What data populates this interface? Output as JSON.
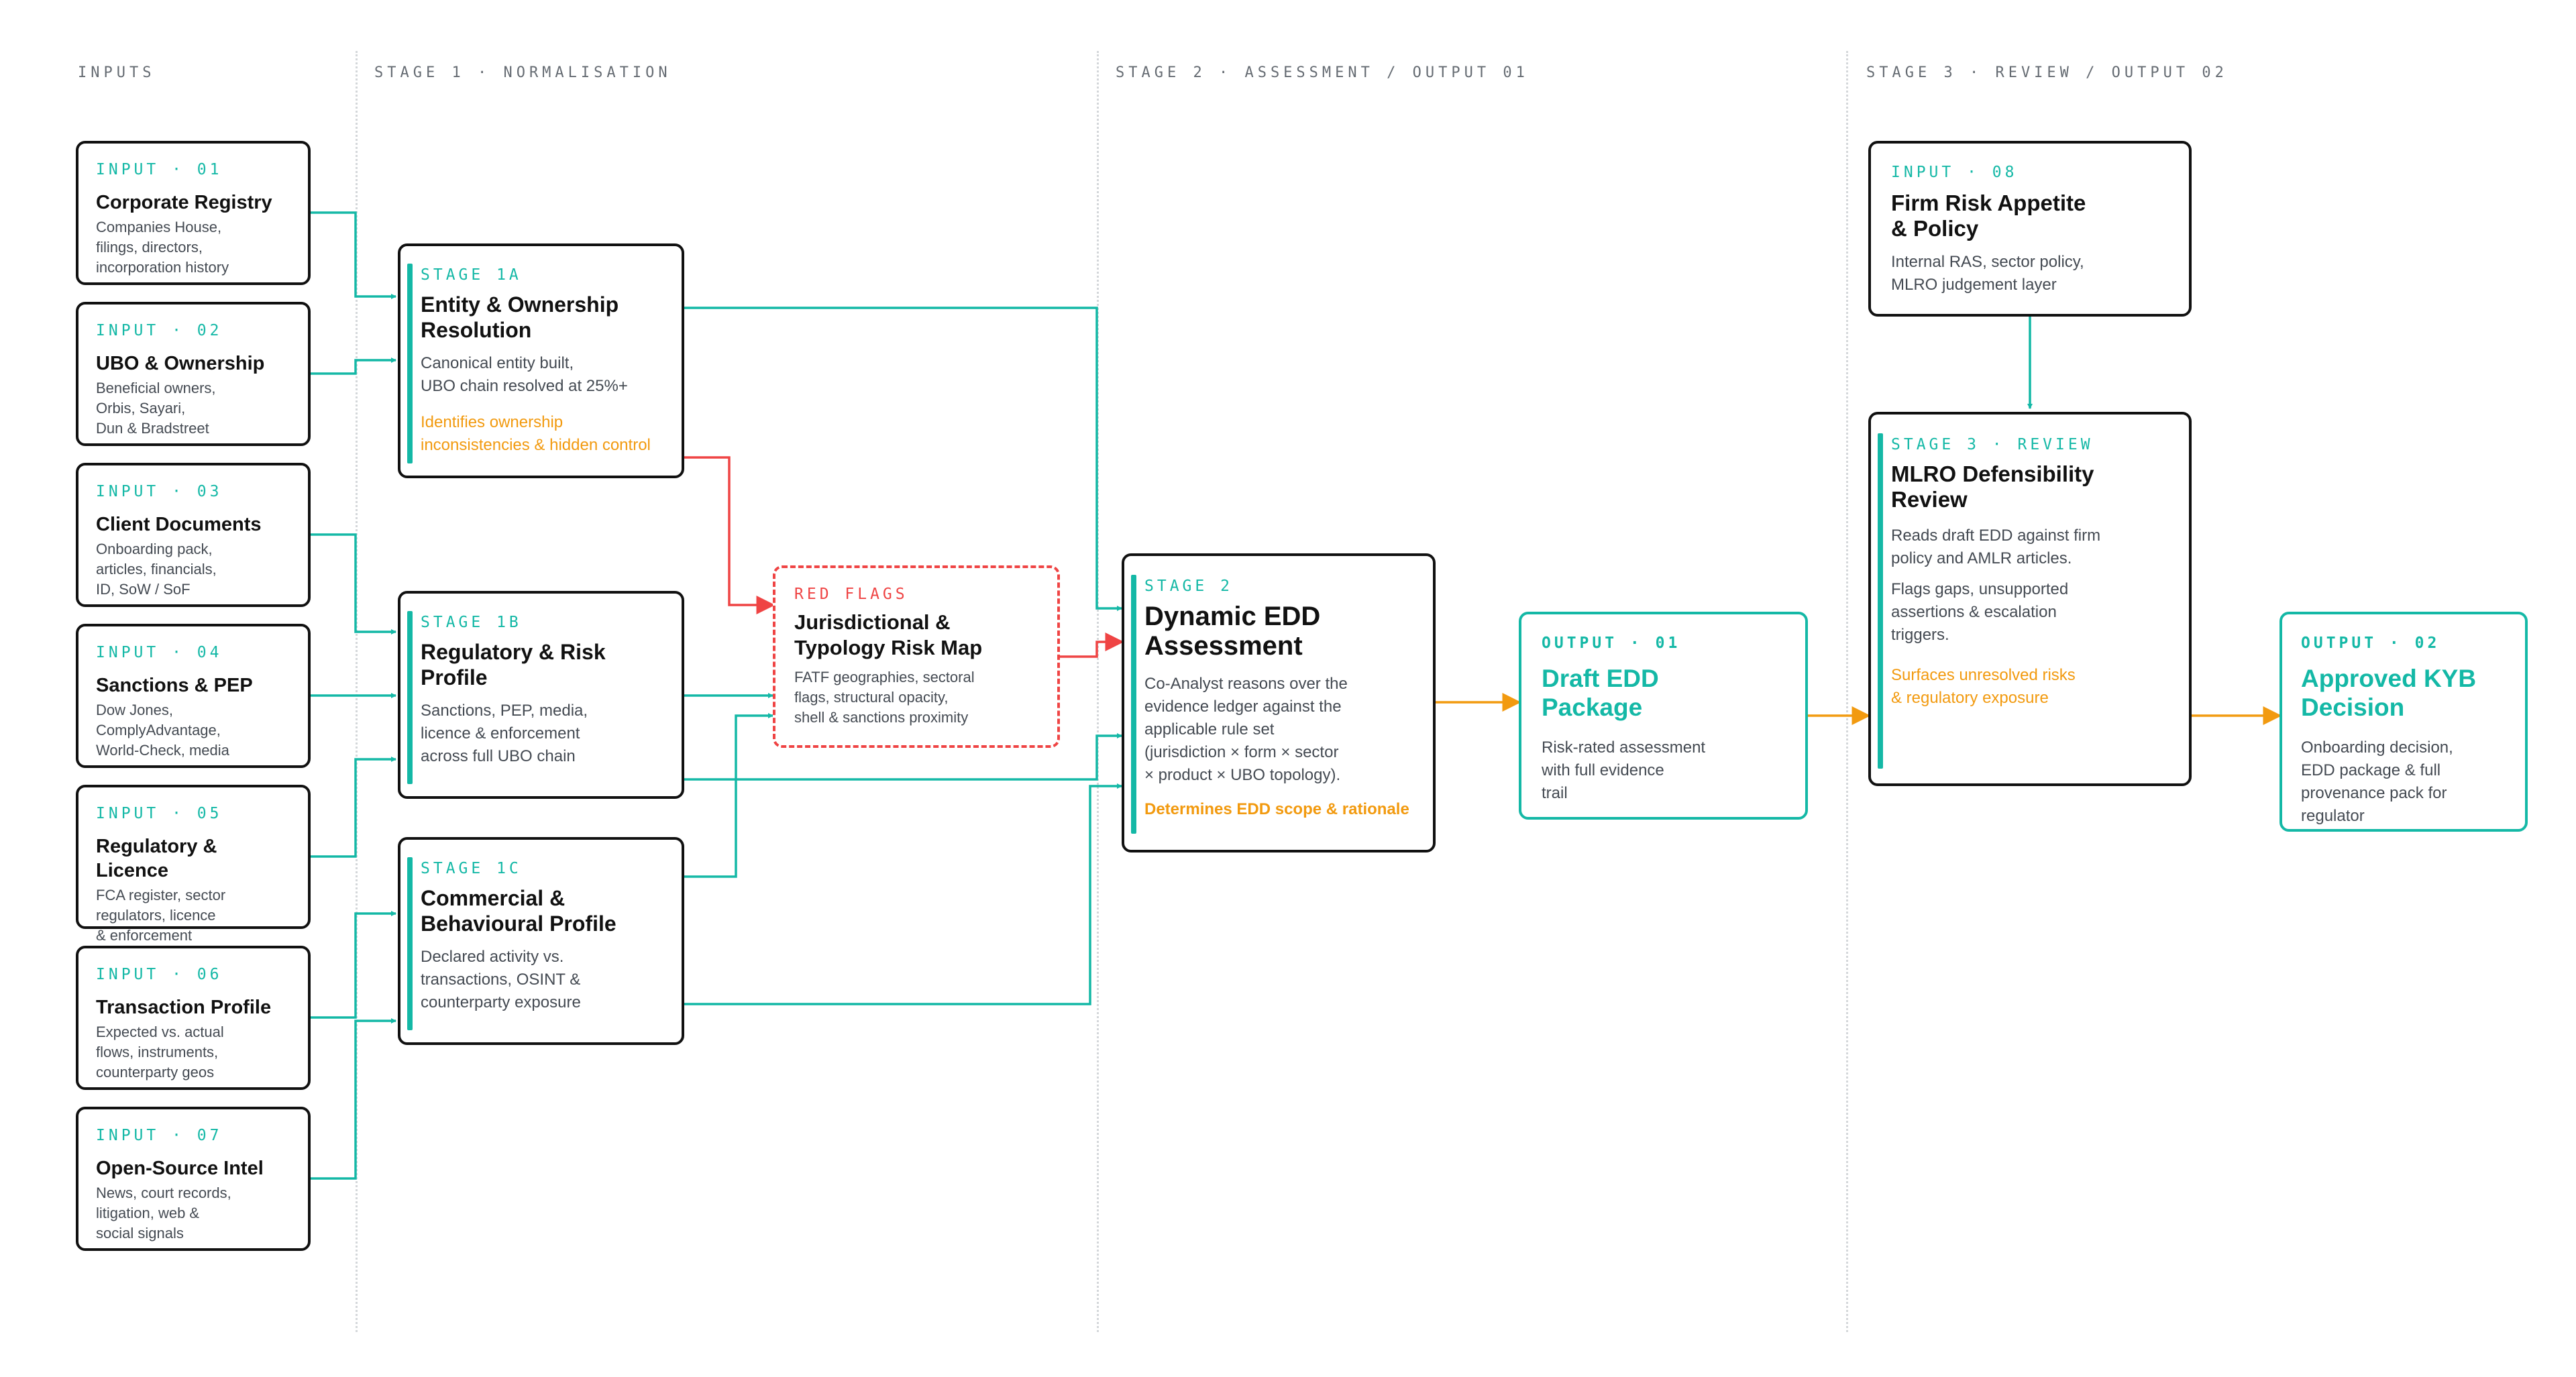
{
  "columns": {
    "inputs": "INPUTS",
    "stage1": "STAGE 1 · NORMALISATION",
    "stage2": "STAGE 2 · ASSESSMENT / OUTPUT 01",
    "stage3": "STAGE 3 · REVIEW / OUTPUT 02"
  },
  "inputs": [
    {
      "tag": "INPUT · 01",
      "title": "Corporate Registry",
      "lines": [
        "Companies House,",
        "filings, directors,",
        "incorporation history"
      ]
    },
    {
      "tag": "INPUT · 02",
      "title": "UBO & Ownership",
      "lines": [
        "Beneficial owners,",
        "Orbis, Sayari,",
        "Dun & Bradstreet"
      ]
    },
    {
      "tag": "INPUT · 03",
      "title": "Client Documents",
      "lines": [
        "Onboarding pack,",
        "articles, financials,",
        "ID, SoW / SoF"
      ]
    },
    {
      "tag": "INPUT · 04",
      "title": "Sanctions & PEP",
      "lines": [
        "Dow Jones,",
        "ComplyAdvantage,",
        "World-Check, media"
      ]
    },
    {
      "tag": "INPUT · 05",
      "title": "Regulatory & Licence",
      "lines": [
        "FCA register, sector",
        "regulators, licence",
        "& enforcement"
      ]
    },
    {
      "tag": "INPUT · 06",
      "title": "Transaction Profile",
      "lines": [
        "Expected vs. actual",
        "flows, instruments,",
        "counterparty geos"
      ]
    },
    {
      "tag": "INPUT · 07",
      "title": "Open-Source Intel",
      "lines": [
        "News, court records,",
        "litigation, web &",
        "social signals"
      ]
    }
  ],
  "stage1a": {
    "tag": "STAGE 1A",
    "title_lines": [
      "Entity & Ownership",
      "Resolution"
    ],
    "desc_lines": [
      "Canonical entity built,",
      "UBO chain resolved at 25%+"
    ],
    "note_lines": [
      "Identifies ownership",
      "inconsistencies & hidden control"
    ]
  },
  "stage1b": {
    "tag": "STAGE 1B",
    "title_lines": [
      "Regulatory & Risk",
      "Profile"
    ],
    "desc_lines": [
      "Sanctions, PEP, media,",
      "licence & enforcement",
      "across full UBO chain"
    ]
  },
  "stage1c": {
    "tag": "STAGE 1C",
    "title_lines": [
      "Commercial &",
      "Behavioural Profile"
    ],
    "desc_lines": [
      "Declared activity vs.",
      "transactions, OSINT &",
      "counterparty exposure"
    ]
  },
  "red_flags": {
    "tag": "RED FLAGS",
    "title_lines": [
      "Jurisdictional &",
      "Typology Risk Map"
    ],
    "desc_lines": [
      "FATF geographies, sectoral",
      "flags, structural opacity,",
      "shell & sanctions proximity"
    ]
  },
  "stage2": {
    "tag": "STAGE 2",
    "title_lines": [
      "Dynamic EDD",
      "Assessment"
    ],
    "desc_lines": [
      "Co-Analyst reasons over the",
      "evidence ledger against the",
      "applicable rule set",
      "(jurisdiction × form × sector",
      "× product × UBO topology)."
    ],
    "note": "Determines EDD scope & rationale"
  },
  "output1": {
    "tag": "OUTPUT · 01",
    "title_lines": [
      "Draft EDD",
      "Package"
    ],
    "desc_lines": [
      "Risk-rated assessment",
      "with full evidence",
      "trail"
    ]
  },
  "input8": {
    "tag": "INPUT · 08",
    "title_lines": [
      "Firm Risk Appetite",
      "& Policy"
    ],
    "desc_lines": [
      "Internal RAS, sector policy,",
      "MLRO judgement layer"
    ]
  },
  "stage3": {
    "tag": "STAGE 3 · REVIEW",
    "title_lines": [
      "MLRO Defensibility",
      "Review"
    ],
    "desc_lines": [
      "Reads draft EDD against firm",
      "policy and AMLR articles."
    ],
    "desc2_lines": [
      "Flags gaps, unsupported",
      "assertions & escalation",
      "triggers."
    ],
    "note_lines": [
      "Surfaces unresolved risks",
      "& regulatory exposure"
    ]
  },
  "output2": {
    "tag": "OUTPUT · 02",
    "title_lines": [
      "Approved KYB",
      "Decision"
    ],
    "desc_lines": [
      "Onboarding decision,",
      "EDD package & full",
      "provenance pack for",
      "regulator"
    ]
  },
  "colors": {
    "teal": "#14b8a6",
    "red": "#ef4444",
    "orange": "#f29a0f",
    "ink": "#111111"
  }
}
